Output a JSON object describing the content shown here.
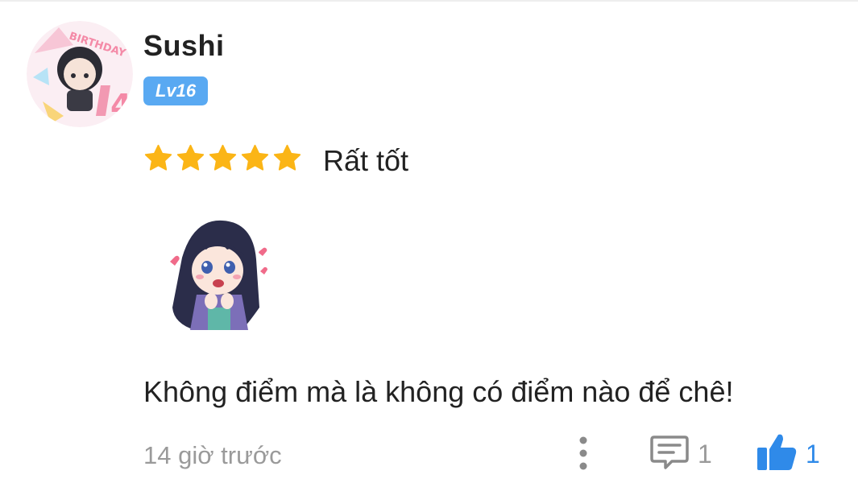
{
  "user": {
    "name": "Sushi",
    "level": "Lv16",
    "avatar_text": "BIRTHDAY 4"
  },
  "rating": {
    "stars": 5,
    "max_stars": 5,
    "label": "Rất tốt",
    "star_color": "#fbb516"
  },
  "review": {
    "text": "Không điểm mà là không có điểm nào để chê!"
  },
  "footer": {
    "timestamp": "14 giờ trước",
    "reply_count": "1",
    "like_count": "1",
    "like_color": "#2f8ae9",
    "icons": [
      "more-icon",
      "comment-icon",
      "thumbs-up-icon"
    ]
  },
  "colors": {
    "level_badge": "#59a9f2",
    "text": "#222222",
    "muted": "#9a9a9a"
  }
}
